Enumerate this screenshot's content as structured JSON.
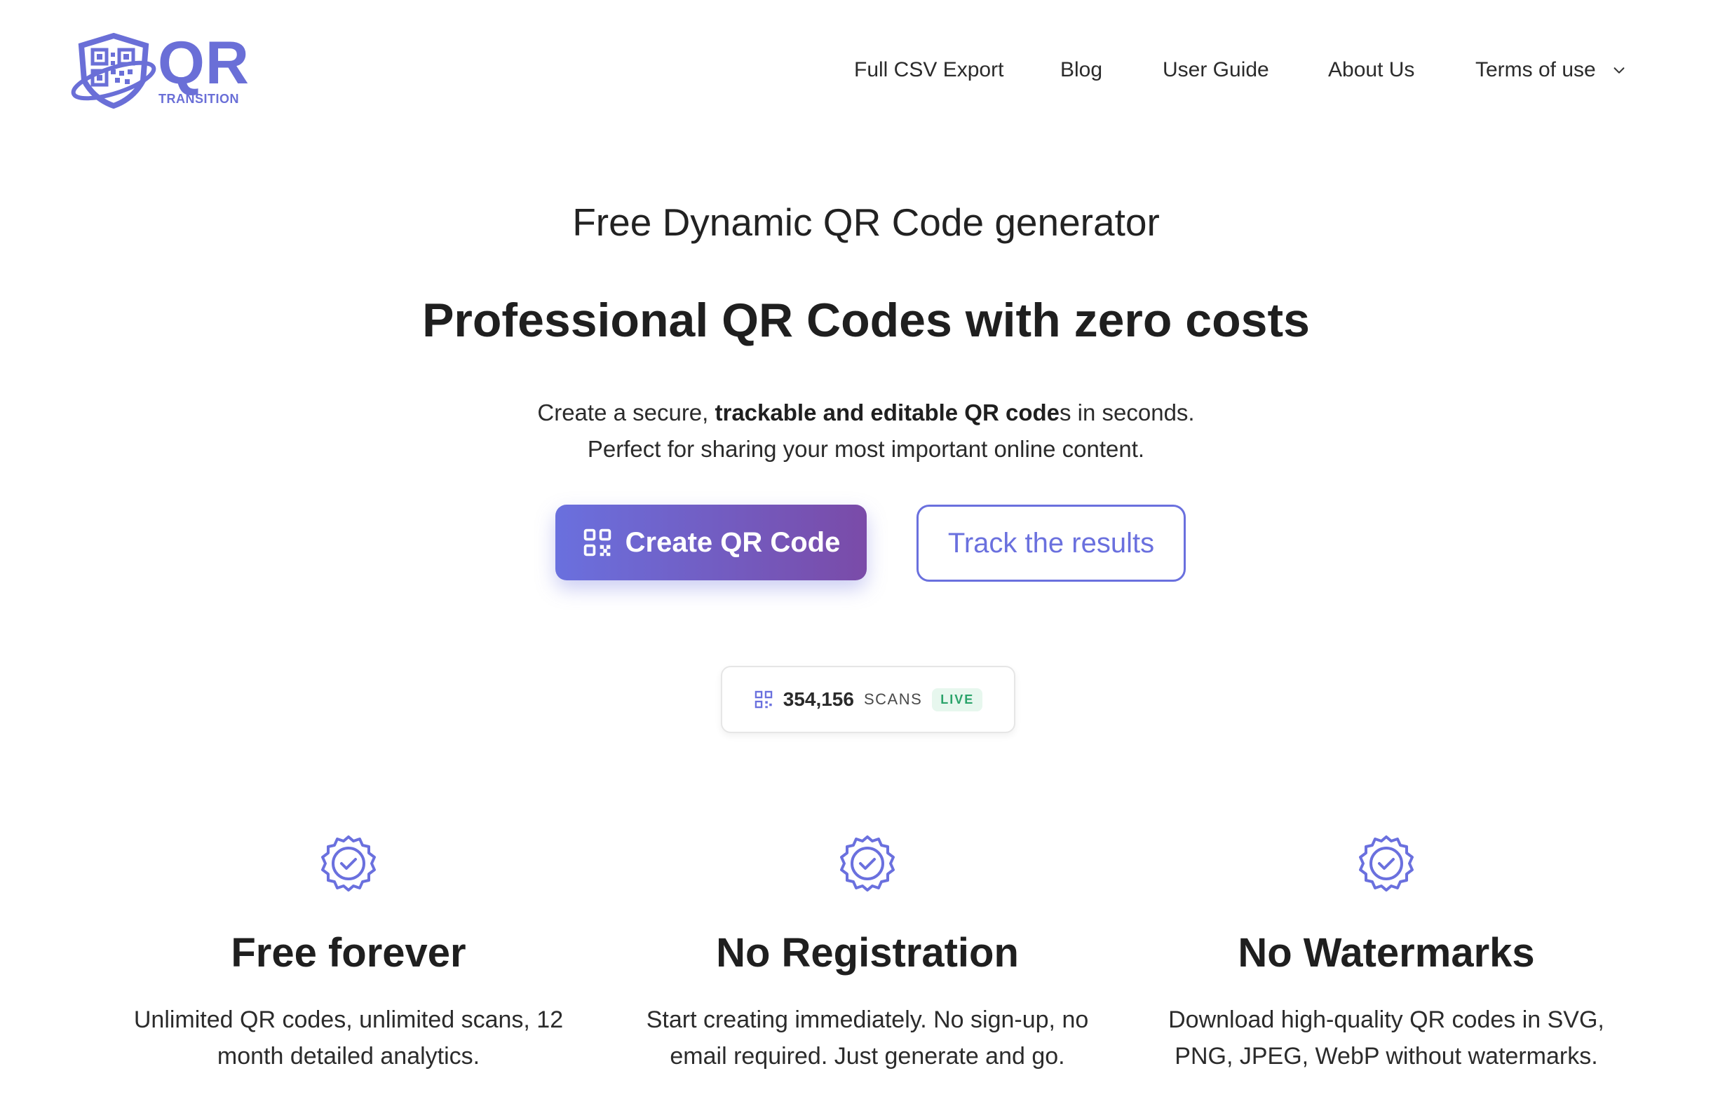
{
  "brand": {
    "logo_text": "QR",
    "logo_sub": "TRANSITION",
    "color": "#6a6fd7"
  },
  "nav": {
    "items": [
      "Full CSV Export",
      "Blog",
      "User Guide",
      "About Us",
      "Terms of use"
    ]
  },
  "hero": {
    "subtitle": "Free Dynamic QR Code generator",
    "title": "Professional QR Codes with zero costs",
    "desc_line1_a": "Create a secure, ",
    "desc_line1_bold": "trackable and editable QR code",
    "desc_line1_b": "s in seconds.",
    "desc_line2": "Perfect for sharing your most important online content.",
    "primary_button": "Create QR Code",
    "secondary_button": "Track the results"
  },
  "stats": {
    "count": "354,156",
    "label": "SCANS",
    "status": "LIVE"
  },
  "features": [
    {
      "title": "Free forever",
      "text": "Unlimited QR codes, unlimited scans, 12 month detailed analytics."
    },
    {
      "title": "No Registration",
      "text": "Start creating immediately. No sign-up, no email required. Just generate and go."
    },
    {
      "title": "No Watermarks",
      "text": "Download high-quality QR codes in SVG, PNG, JPEG, WebP without watermarks."
    }
  ],
  "colors": {
    "accent": "#6a70de",
    "gradient_end": "#7a4ba8",
    "live_green": "#2aa36a"
  }
}
